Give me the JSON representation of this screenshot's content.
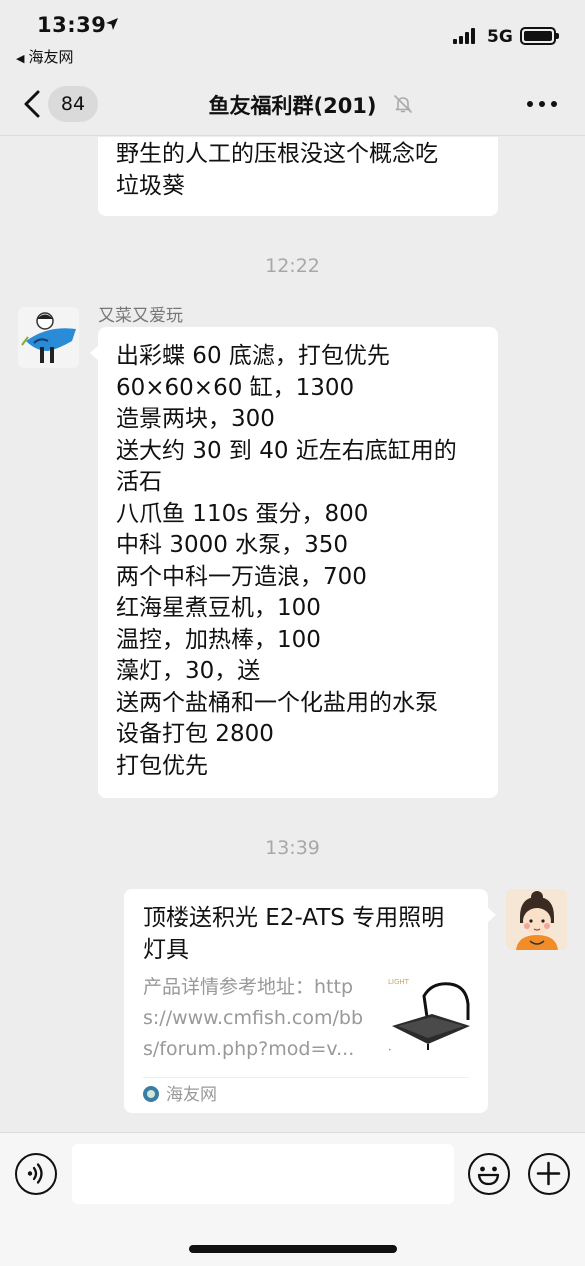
{
  "status_bar": {
    "time": "13:39",
    "back_app_label": "海友网",
    "network": "5G"
  },
  "nav": {
    "unread_count": "84",
    "title": "鱼友福利群(201)"
  },
  "messages": {
    "partial_text": [
      "野生的人工的压根没这个概念吃",
      "垃圾葵"
    ],
    "timestamp_1": "12:22",
    "sender_name": "又菜又爱玩",
    "main_lines": [
      "出彩蝶 60 底滤，打包优先",
      "60×60×60 缸，1300",
      "造景两块，300",
      "送大约 30 到 40 近左右底缸用的",
      "活石",
      "八爪鱼 110s 蛋分，800",
      "中科 3000 水泵，350",
      "两个中科一万造浪，700",
      "红海星煮豆机，100",
      "温控，加热棒，100",
      "藻灯，30，送",
      "送两个盐桶和一个化盐用的水泵",
      "设备打包 2800",
      "打包优先"
    ],
    "timestamp_2": "13:39"
  },
  "link_card": {
    "title": "顶楼送积光 E2-ATS 专用照明灯具",
    "description": "产品详情参考地址：https://www.cmfish.com/bbs/forum.php?mod=v...",
    "thumb_label": "LIGHT",
    "source": "海友网"
  },
  "icons": {
    "back": "chevron-left-icon",
    "mute": "bell-slash-icon",
    "more": "more-dots-icon",
    "voice": "voice-icon",
    "emoji": "emoji-icon",
    "plus": "plus-icon"
  }
}
